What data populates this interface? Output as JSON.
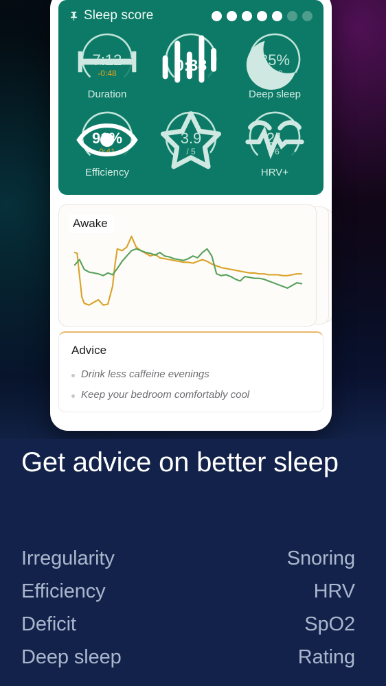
{
  "score_card": {
    "pin_icon": "pin-icon",
    "title": "Sleep score",
    "dots": {
      "total": 7,
      "filled": 5
    },
    "gauges": [
      {
        "id": "duration",
        "icon": "duration-icon",
        "value": "7:12",
        "sub": "-0:48",
        "sub_style": "warn",
        "label": "Duration",
        "percent": 82,
        "bright": false
      },
      {
        "id": "noise",
        "icon": "noise-icon",
        "value": "0:38",
        "sub": "",
        "sub_style": "",
        "label": "",
        "percent": 88,
        "bright": true
      },
      {
        "id": "deep-sleep",
        "icon": "moon-icon",
        "value": "35%",
        "sub": "2:30",
        "sub_style": "normal",
        "label": "Deep sleep",
        "percent": 95,
        "bright": false
      },
      {
        "id": "efficiency",
        "icon": "eye-icon",
        "value": "91%",
        "sub": "0:41",
        "sub_style": "warn",
        "label": "Efficiency",
        "percent": 91,
        "bright": true
      },
      {
        "id": "rating",
        "icon": "star-icon",
        "value": "3.9",
        "sub": "/ 5",
        "sub_style": "normal",
        "label": "",
        "percent": 97,
        "bright": false
      },
      {
        "id": "hrv",
        "icon": "heartbeat-icon",
        "value": "21",
        "sub": "+6",
        "sub_style": "normal",
        "label": "HRV+",
        "percent": 96,
        "bright": false
      }
    ]
  },
  "chart_card": {
    "awake_label": "Awake"
  },
  "advice_card": {
    "title": "Advice",
    "items": [
      "Drink less caffeine evenings",
      "Keep your bedroom comfortably cool"
    ]
  },
  "promo": {
    "headline": "Get advice on better sleep",
    "features_left": [
      "Irregularity",
      "Efficiency",
      "Deficit",
      "Deep sleep"
    ],
    "features_right": [
      "Snoring",
      "HRV",
      "SpO2",
      "Rating"
    ]
  },
  "colors": {
    "card_teal": "#0c7a66",
    "promo_navy": "#13224a",
    "accent_amber": "#e8a21e",
    "chart_orange": "#d9a227",
    "chart_green": "#56a05a",
    "ring_track": "#3a9a85",
    "ring_fill": "#bfe4da"
  },
  "chart_data": {
    "type": "line",
    "title": "",
    "xlabel": "",
    "ylabel": "",
    "annotations": [
      "Awake"
    ],
    "grid": false,
    "legend": "none",
    "xlim": [
      0,
      100
    ],
    "ylim": [
      0,
      100
    ],
    "series": [
      {
        "name": "orange-trace",
        "color": "#d9a227",
        "x": [
          2,
          3,
          4,
          5,
          6,
          8,
          10,
          12,
          14,
          16,
          18,
          19,
          20,
          22,
          24,
          26,
          27,
          28,
          30,
          32,
          34,
          36,
          38,
          40,
          42,
          44,
          46,
          48,
          50,
          52,
          54,
          56,
          58,
          60,
          62,
          64,
          66,
          68,
          70,
          72,
          74,
          76,
          78,
          80,
          82,
          84,
          86,
          88,
          90,
          92,
          94,
          96,
          98
        ],
        "y": [
          70,
          69,
          44,
          20,
          13,
          11,
          14,
          17,
          11,
          12,
          32,
          56,
          74,
          72,
          76,
          88,
          82,
          76,
          72,
          69,
          66,
          68,
          64,
          63,
          62,
          61,
          60,
          59,
          59,
          58,
          60,
          62,
          60,
          57,
          55,
          53,
          52,
          51,
          50,
          49,
          48,
          47,
          47,
          46,
          46,
          45,
          45,
          45,
          44,
          44,
          45,
          46,
          46
        ]
      },
      {
        "name": "green-trace",
        "color": "#56a05a",
        "x": [
          2,
          4,
          6,
          8,
          10,
          12,
          14,
          16,
          18,
          20,
          22,
          24,
          26,
          28,
          30,
          32,
          34,
          36,
          38,
          40,
          42,
          44,
          46,
          48,
          50,
          52,
          54,
          56,
          58,
          60,
          62,
          64,
          66,
          68,
          70,
          72,
          74,
          76,
          78,
          80,
          82,
          84,
          86,
          88,
          90,
          92,
          94,
          96,
          98
        ],
        "y": [
          56,
          62,
          51,
          48,
          47,
          46,
          44,
          47,
          45,
          52,
          60,
          66,
          72,
          74,
          72,
          70,
          69,
          67,
          70,
          66,
          65,
          63,
          62,
          61,
          63,
          66,
          64,
          70,
          74,
          66,
          46,
          44,
          45,
          43,
          40,
          38,
          43,
          42,
          41,
          41,
          40,
          38,
          36,
          34,
          32,
          30,
          33,
          36,
          35
        ]
      }
    ]
  }
}
